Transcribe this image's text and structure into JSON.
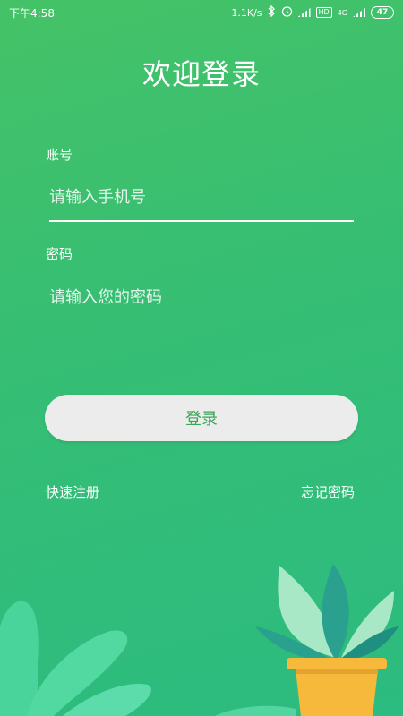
{
  "status": {
    "time": "下午4:58",
    "speed": "1.1K/s",
    "hd": "HD",
    "network": "4G",
    "battery": "47"
  },
  "login": {
    "title": "欢迎登录",
    "account_label": "账号",
    "account_placeholder": "请输入手机号",
    "password_label": "密码",
    "password_placeholder": "请输入您的密码",
    "login_button": "登录",
    "register_link": "快速注册",
    "forgot_link": "忘记密码"
  },
  "colors": {
    "background": "#39bf72",
    "button_bg": "#ececec",
    "button_text": "#3aa659",
    "pot": "#f6b93b"
  }
}
